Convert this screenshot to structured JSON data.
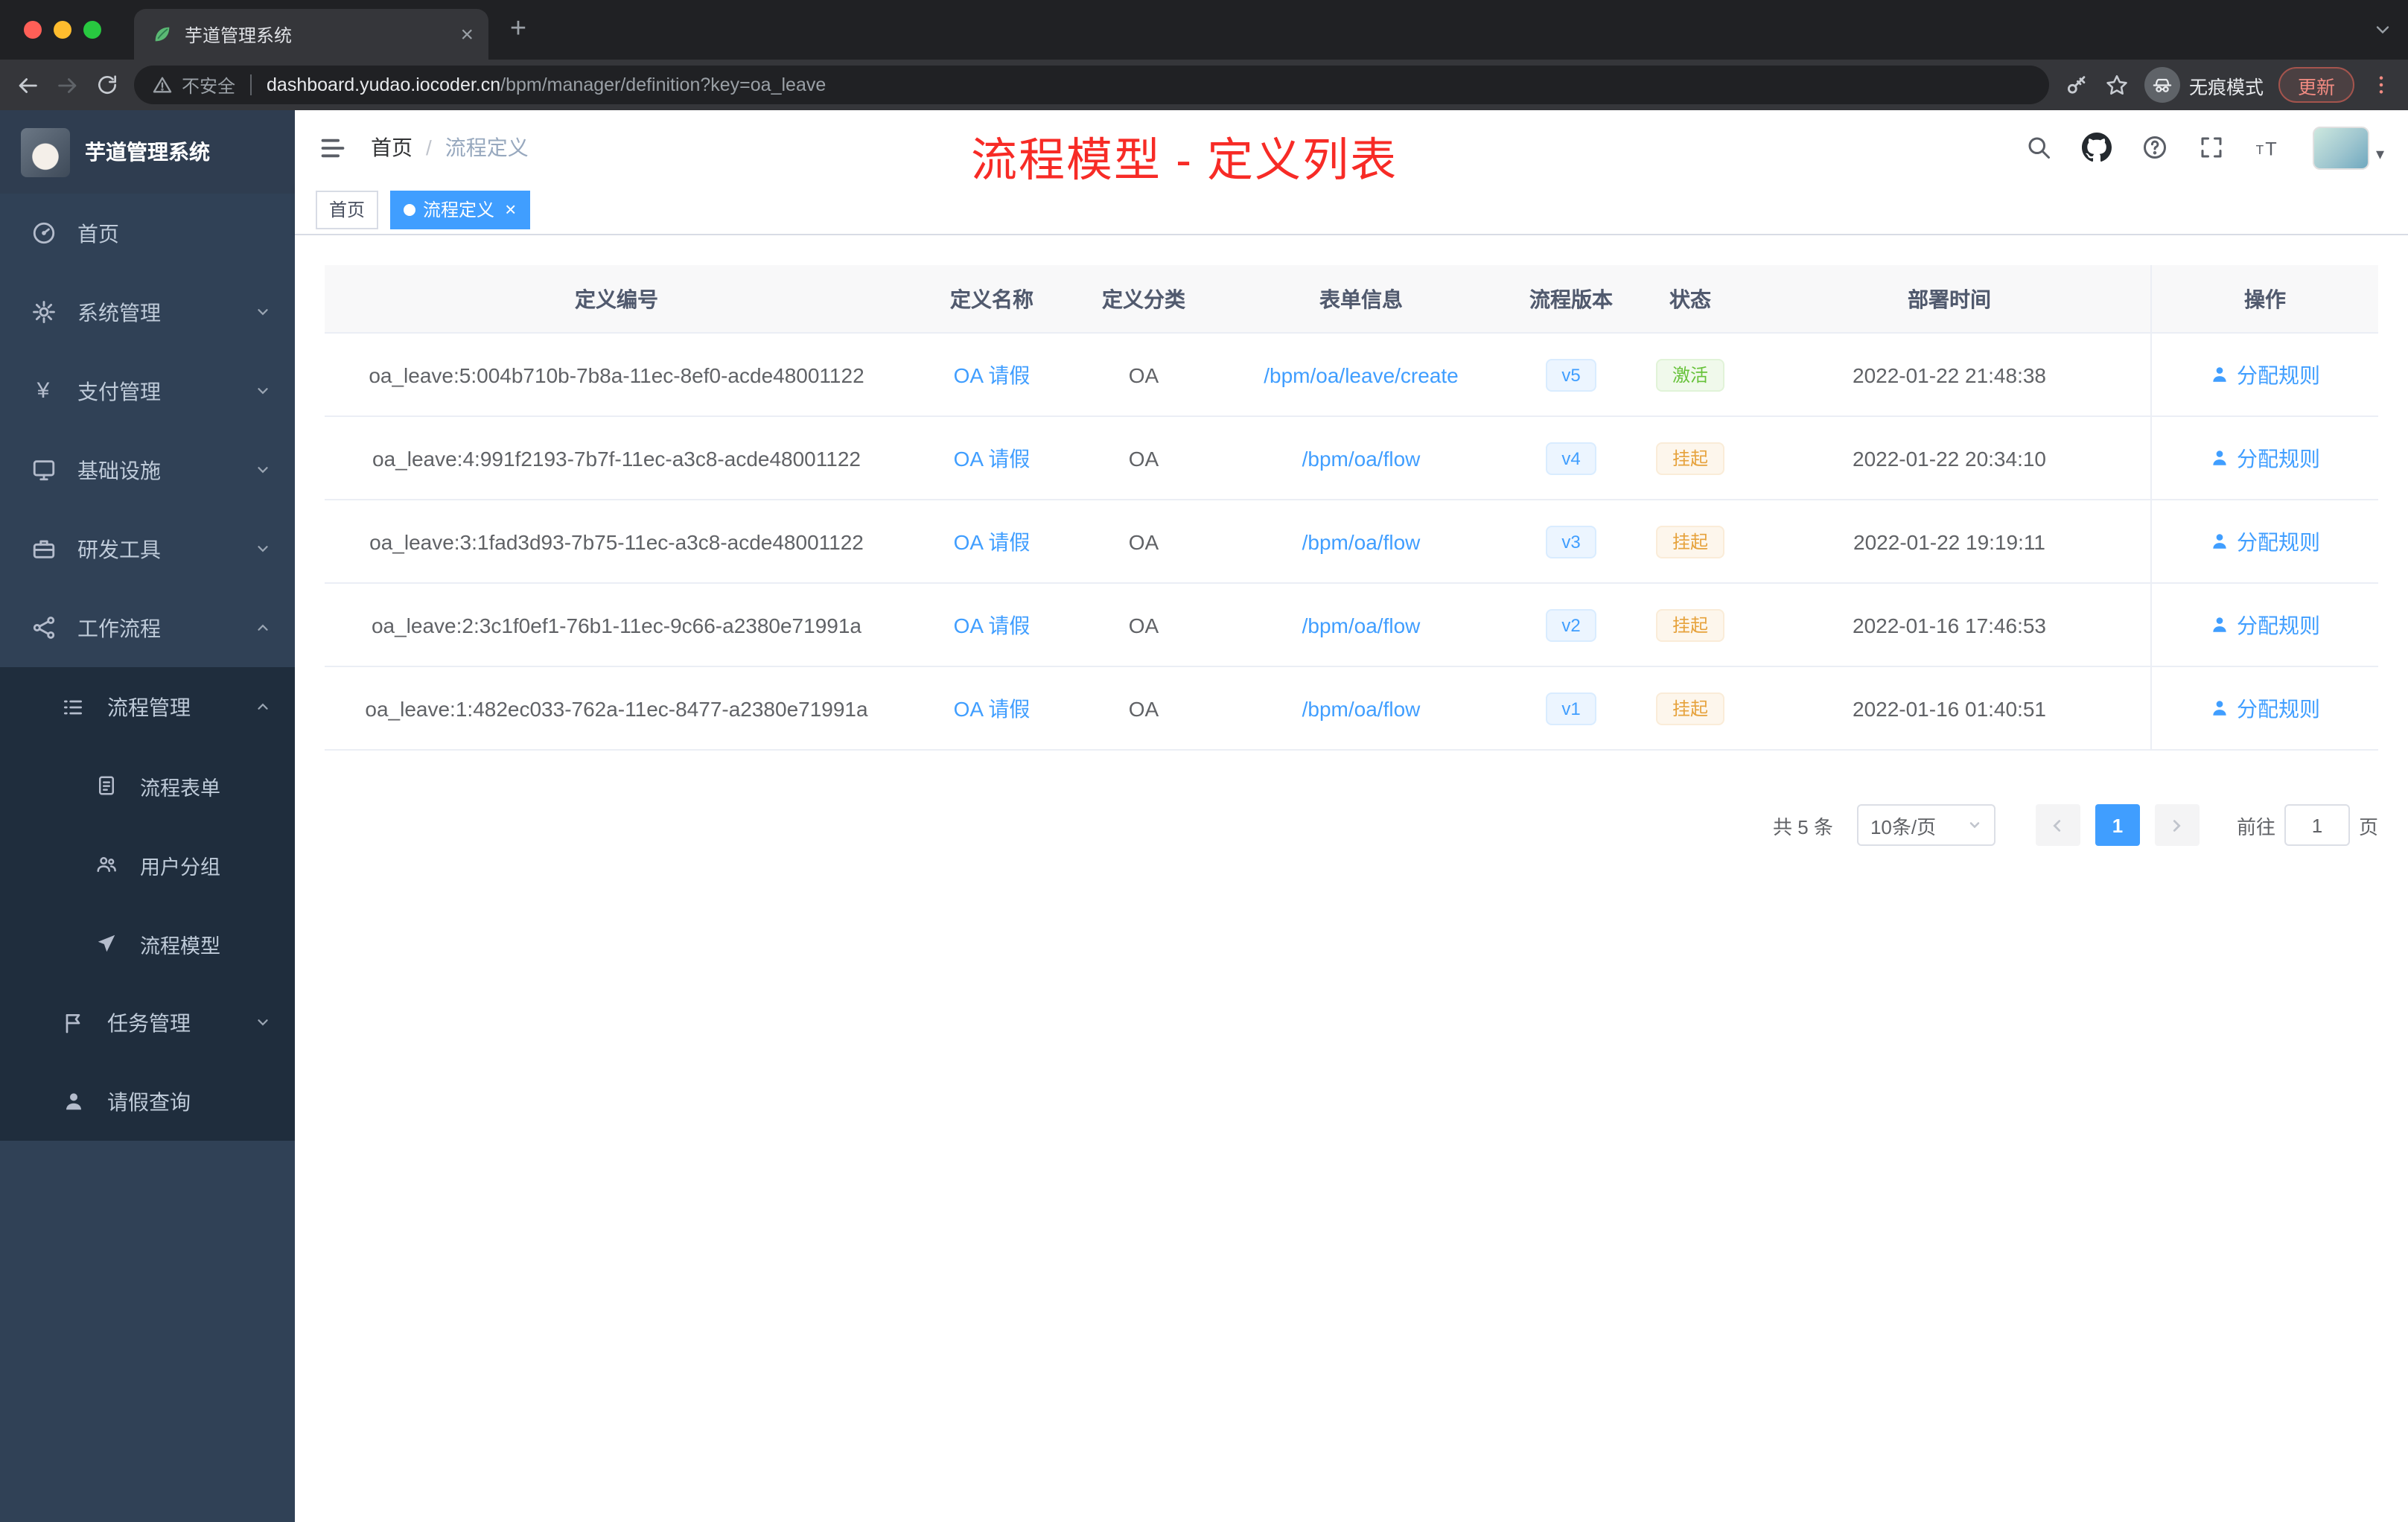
{
  "browser": {
    "tab_title": "芋道管理系统",
    "security": "不安全",
    "host": "dashboard.yudao.iocoder.cn",
    "path": "/bpm/manager/definition?key=oa_leave",
    "incognito": "无痕模式",
    "update": "更新"
  },
  "sidebar": {
    "logo_title": "芋道管理系统",
    "items": [
      {
        "label": "首页",
        "icon": "dashboard-icon"
      },
      {
        "label": "系统管理",
        "icon": "gear-icon"
      },
      {
        "label": "支付管理",
        "icon": "yen-icon"
      },
      {
        "label": "基础设施",
        "icon": "monitor-icon"
      },
      {
        "label": "研发工具",
        "icon": "toolbox-icon"
      },
      {
        "label": "工作流程",
        "icon": "workflow-icon"
      },
      {
        "label": "流程管理",
        "icon": "list-icon"
      },
      {
        "label": "流程表单",
        "icon": "form-icon"
      },
      {
        "label": "用户分组",
        "icon": "user-group-icon"
      },
      {
        "label": "流程模型",
        "icon": "paper-plane-icon"
      },
      {
        "label": "任务管理",
        "icon": "task-icon"
      },
      {
        "label": "请假查询",
        "icon": "user-icon"
      }
    ]
  },
  "header": {
    "breadcrumb": [
      "首页",
      "流程定义"
    ],
    "separator": "/",
    "annotation": "流程模型 - 定义列表"
  },
  "tags": [
    {
      "label": "首页",
      "active": false
    },
    {
      "label": "流程定义",
      "active": true
    }
  ],
  "table": {
    "columns": [
      "定义编号",
      "定义名称",
      "定义分类",
      "表单信息",
      "流程版本",
      "状态",
      "部署时间",
      "操作"
    ],
    "rows": [
      {
        "id": "oa_leave:5:004b710b-7b8a-11ec-8ef0-acde48001122",
        "name": "OA 请假",
        "category": "OA",
        "form": "/bpm/oa/leave/create",
        "version": "v5",
        "status": "激活",
        "status_type": "success",
        "time": "2022-01-22 21:48:38",
        "action": "分配规则"
      },
      {
        "id": "oa_leave:4:991f2193-7b7f-11ec-a3c8-acde48001122",
        "name": "OA 请假",
        "category": "OA",
        "form": "/bpm/oa/flow",
        "version": "v4",
        "status": "挂起",
        "status_type": "warning",
        "time": "2022-01-22 20:34:10",
        "action": "分配规则"
      },
      {
        "id": "oa_leave:3:1fad3d93-7b75-11ec-a3c8-acde48001122",
        "name": "OA 请假",
        "category": "OA",
        "form": "/bpm/oa/flow",
        "version": "v3",
        "status": "挂起",
        "status_type": "warning",
        "time": "2022-01-22 19:19:11",
        "action": "分配规则"
      },
      {
        "id": "oa_leave:2:3c1f0ef1-76b1-11ec-9c66-a2380e71991a",
        "name": "OA 请假",
        "category": "OA",
        "form": "/bpm/oa/flow",
        "version": "v2",
        "status": "挂起",
        "status_type": "warning",
        "time": "2022-01-16 17:46:53",
        "action": "分配规则"
      },
      {
        "id": "oa_leave:1:482ec033-762a-11ec-8477-a2380e71991a",
        "name": "OA 请假",
        "category": "OA",
        "form": "/bpm/oa/flow",
        "version": "v1",
        "status": "挂起",
        "status_type": "warning",
        "time": "2022-01-16 01:40:51",
        "action": "分配规则"
      }
    ]
  },
  "pagination": {
    "total": "共 5 条",
    "page_size": "10条/页",
    "current": "1",
    "goto_label": "前往",
    "page_unit": "页",
    "goto_value": "1"
  },
  "colors": {
    "accent": "#409eff",
    "success": "#67c23a",
    "warning": "#e6a23c",
    "annotation_red": "#f72b26",
    "sidebar_bg": "#304156",
    "submenu_bg": "#1f2d3d"
  }
}
